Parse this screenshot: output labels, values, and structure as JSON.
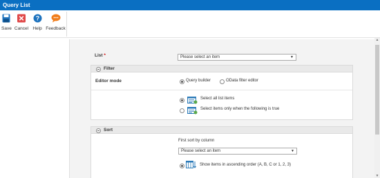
{
  "window": {
    "title": "Query List"
  },
  "toolbar": {
    "save_label": "Save",
    "cancel_label": "Cancel",
    "help_label": "Help",
    "feedback_label": "Feedback"
  },
  "form": {
    "list": {
      "label": "List",
      "required_mark": "*",
      "placeholder": "Please select an item"
    },
    "filter": {
      "section_title": "Filter",
      "editor_mode_label": "Editor mode",
      "editor_options": [
        "Query builder",
        "OData filter editor"
      ],
      "item_options": [
        "Select all list items",
        "Select items only when the following is true"
      ]
    },
    "sort": {
      "section_title": "Sort",
      "first_sort_label": "First sort by column",
      "column_placeholder": "Please select an item",
      "order_option": "Show items in ascending order (A, B, C or 1, 2, 3)"
    }
  },
  "icons": {
    "save": "save-icon",
    "cancel": "cancel-icon",
    "help": "help-icon",
    "feedback": "feedback-icon"
  },
  "colors": {
    "titlebar": "#0a6fc2",
    "save": "#1e73be",
    "cancel": "#e04848",
    "help": "#1e73be",
    "feedback": "#f07d1b"
  }
}
